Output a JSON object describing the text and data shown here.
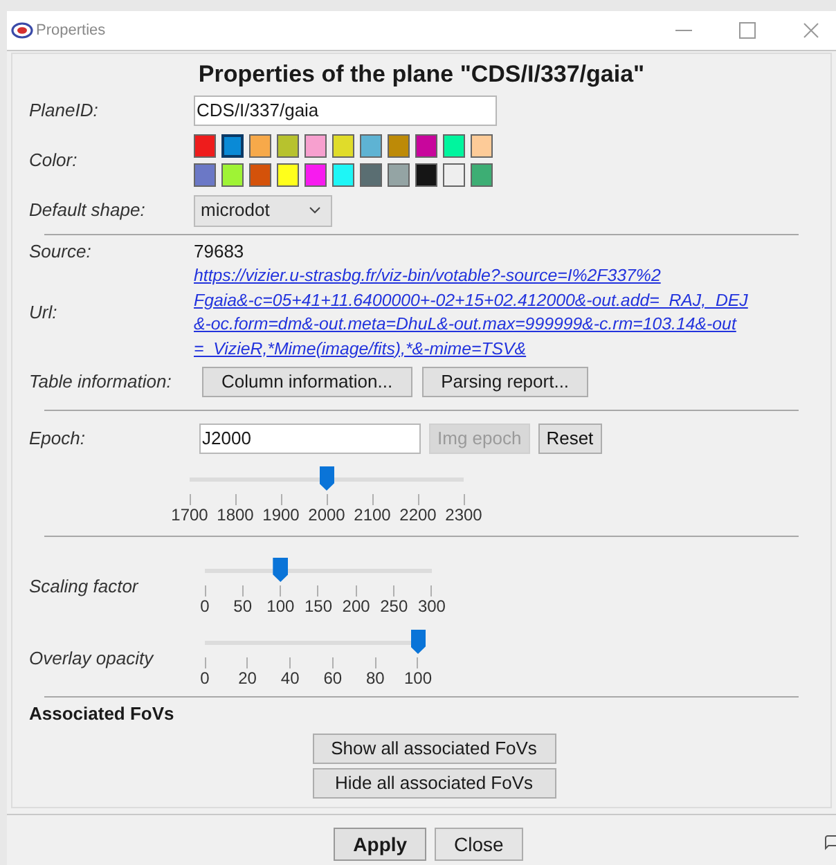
{
  "window": {
    "title": "Properties"
  },
  "heading": "Properties of the plane \"CDS/I/337/gaia\"",
  "plane_id": {
    "label": "PlaneID:",
    "value": "CDS/I/337/gaia"
  },
  "color": {
    "label": "Color:",
    "swatches": [
      {
        "color": "#ee1c1c",
        "selected": false
      },
      {
        "color": "#0a8ad6",
        "selected": true
      },
      {
        "color": "#f7a94a",
        "selected": false
      },
      {
        "color": "#b7c22e",
        "selected": false
      },
      {
        "color": "#f7a0cf",
        "selected": false
      },
      {
        "color": "#e0dc2a",
        "selected": false
      },
      {
        "color": "#5eb3d3",
        "selected": false
      },
      {
        "color": "#bd8a07",
        "selected": false
      },
      {
        "color": "#c8069c",
        "selected": false
      },
      {
        "color": "#00f59e",
        "selected": false
      },
      {
        "color": "#fdcb98",
        "selected": false
      },
      {
        "color": "#6b78c6",
        "selected": false
      },
      {
        "color": "#9ff335",
        "selected": false
      },
      {
        "color": "#d4520a",
        "selected": false
      },
      {
        "color": "#ffff1b",
        "selected": false
      },
      {
        "color": "#f71bef",
        "selected": false
      },
      {
        "color": "#1ef6f6",
        "selected": false
      },
      {
        "color": "#5a6e72",
        "selected": false
      },
      {
        "color": "#94a4a4",
        "selected": false
      },
      {
        "color": "#151515",
        "selected": false
      },
      {
        "color": "#eeeeee",
        "selected": false
      },
      {
        "color": "#3dae74",
        "selected": false
      }
    ]
  },
  "default_shape": {
    "label": "Default shape:",
    "value": "microdot"
  },
  "source": {
    "label": "Source:",
    "value": "79683"
  },
  "url": {
    "label": "Url:",
    "lines": [
      "https://vizier.u-strasbg.fr/viz-bin/votable?-source=I%2F337%2",
      "Fgaia&-c=05+41+11.6400000+-02+15+02.412000&-out.add=_RAJ,_DEJ",
      "&-oc.form=dm&-out.meta=DhuL&-out.max=999999&-c.rm=103.14&-out",
      "=_VizieR,*Mime(image/fits),*&-mime=TSV&"
    ]
  },
  "table_information": {
    "label": "Table information:",
    "buttons": [
      "Column information...",
      "Parsing report..."
    ]
  },
  "epoch": {
    "label": "Epoch:",
    "value": "J2000",
    "buttons": [
      {
        "label": "Img epoch",
        "disabled": true
      },
      {
        "label": "Reset",
        "disabled": false
      }
    ]
  },
  "sliders": [
    {
      "level": 0.5,
      "ticks": [
        "1700",
        "1800",
        "1900",
        "2000",
        "2100",
        "2200",
        "2300"
      ]
    },
    {
      "label": "Scaling factor",
      "level": 0.3333,
      "ticks": [
        "0",
        "50",
        "100",
        "150",
        "200",
        "250",
        "300"
      ]
    },
    {
      "label": "Overlay opacity",
      "level": 1,
      "ticks": [
        "0",
        "20",
        "40",
        "60",
        "80",
        "100"
      ]
    }
  ],
  "associated_fovs": {
    "title": "Associated FoVs",
    "buttons": [
      "Show all associated FoVs",
      "Hide all associated FoVs"
    ]
  },
  "footer_buttons": [
    {
      "label": "Apply",
      "default": true
    },
    {
      "label": "Close",
      "default": false
    }
  ]
}
